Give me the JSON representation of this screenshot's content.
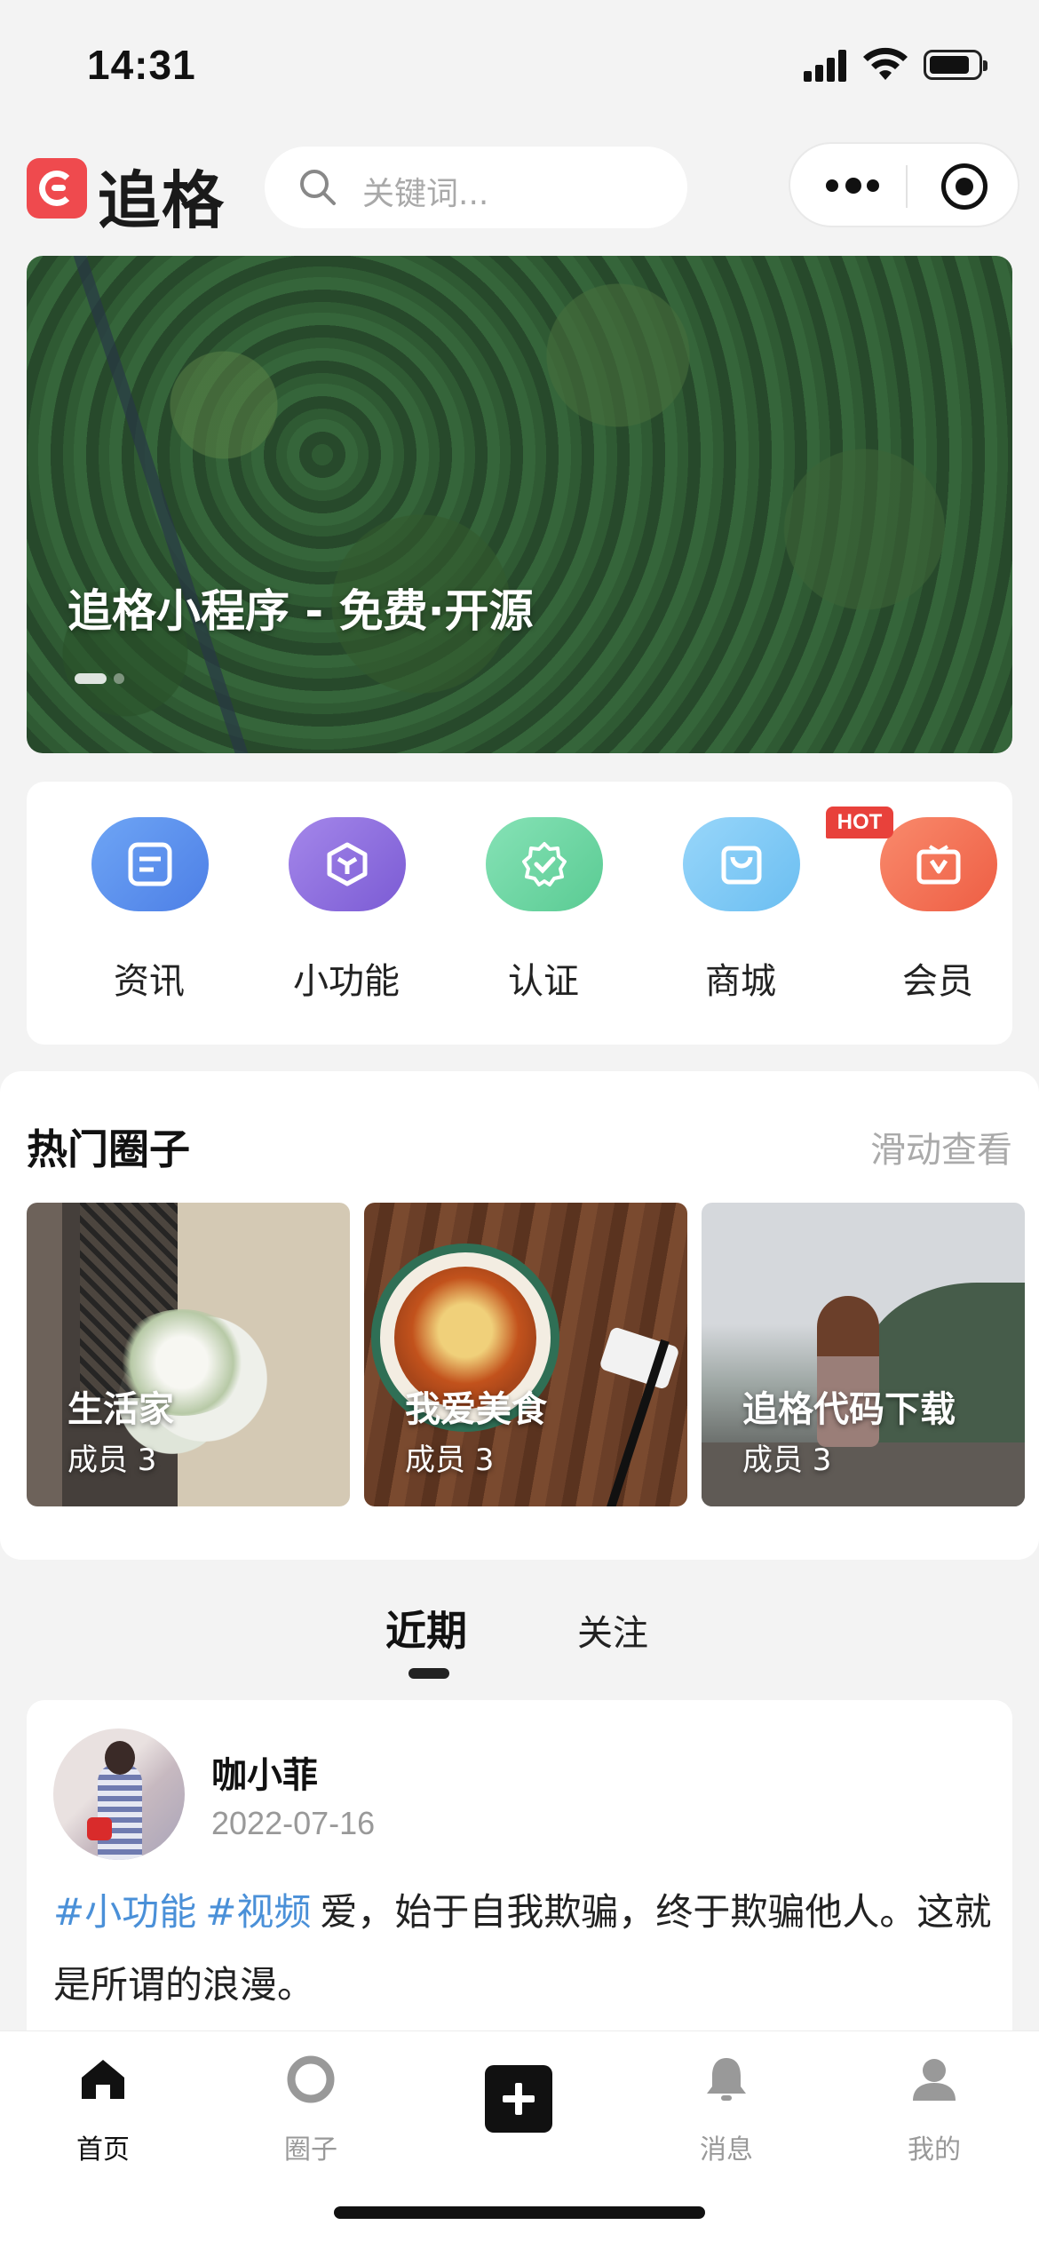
{
  "status_bar": {
    "time": "14:31"
  },
  "header": {
    "brand": "追格",
    "search_placeholder": "关键词..."
  },
  "banner": {
    "title": "追格小程序 - 免费·开源"
  },
  "quick_menu": {
    "items": [
      {
        "label": "资讯",
        "color": "#5b8ff0"
      },
      {
        "label": "小功能",
        "color": "#8e6fdc"
      },
      {
        "label": "认证",
        "color": "#6fd6a3"
      },
      {
        "label": "商城",
        "color": "#7cc6f5"
      },
      {
        "label": "会员",
        "color": "#f37154"
      }
    ],
    "hot_badge": "HOT"
  },
  "hot_circles": {
    "title": "热门圈子",
    "more": "滑动查看",
    "cards": [
      {
        "name": "生活家",
        "members": "成员 3"
      },
      {
        "name": "我爱美食",
        "members": "成员 3"
      },
      {
        "name": "追格代码下载",
        "members": "成员 3"
      }
    ]
  },
  "feed_tabs": {
    "recent": "近期",
    "follow": "关注"
  },
  "post": {
    "author": "咖小菲",
    "date": "2022-07-16",
    "tags": [
      "#小功能",
      "#视频"
    ],
    "text": "爱，始于自我欺骗，终于欺骗他人。这就是所谓的浪漫。"
  },
  "bottom_nav": {
    "items": [
      {
        "label": "首页"
      },
      {
        "label": "圈子"
      },
      {
        "label": "消息"
      },
      {
        "label": "我的"
      }
    ]
  }
}
